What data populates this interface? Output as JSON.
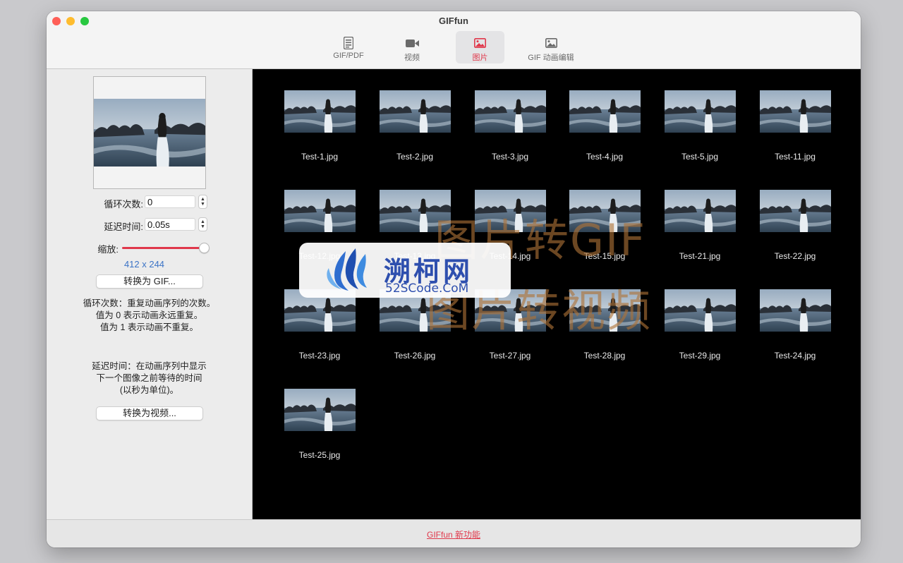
{
  "window": {
    "title": "GIFfun"
  },
  "toolbar": {
    "tabs": [
      {
        "label": "GIF/PDF",
        "icon": "document-icon",
        "active": false
      },
      {
        "label": "视频",
        "icon": "video-camera-icon",
        "active": false
      },
      {
        "label": "图片",
        "icon": "image-icon",
        "active": true
      },
      {
        "label": "GIF 动画编辑",
        "icon": "image-icon",
        "active": false
      }
    ]
  },
  "sidebar": {
    "loop_label": "循环次数:",
    "loop_value": "0",
    "delay_label": "延迟时间:",
    "delay_value": "0.05s",
    "scale_label": "缩放:",
    "scale_level": 1.0,
    "dimensions": "412 x 244",
    "convert_gif_button": "转换为 GIF...",
    "loop_help": [
      "循环次数：重复动画序列的次数。",
      "值为 0 表示动画永远重复。",
      "值为 1 表示动画不重复。"
    ],
    "delay_help": [
      "延迟时间：在动画序列中显示",
      "下一个图像之前等待的时间",
      "(以秒为单位)。"
    ],
    "convert_video_button": "转换为视频..."
  },
  "gallery": {
    "files": [
      "Test-1.jpg",
      "Test-2.jpg",
      "Test-3.jpg",
      "Test-4.jpg",
      "Test-5.jpg",
      "Test-11.jpg",
      "Test-12.jpg",
      "Test-13.jpg",
      "Test-14.jpg",
      "Test-15.jpg",
      "Test-21.jpg",
      "Test-22.jpg",
      "Test-23.jpg",
      "Test-26.jpg",
      "Test-27.jpg",
      "Test-28.jpg",
      "Test-29.jpg",
      "Test-24.jpg",
      "Test-25.jpg"
    ],
    "overlay_line1": "图片转GIF",
    "overlay_line2": "图片转视频"
  },
  "watermark": {
    "title": "溯柯网",
    "subtitle": "52SCode.CoM"
  },
  "footer": {
    "link": "GIFfun 新功能"
  },
  "colors": {
    "accent": "#e0384b",
    "link_blue": "#3b73c6",
    "gallery_bg": "#000000"
  }
}
